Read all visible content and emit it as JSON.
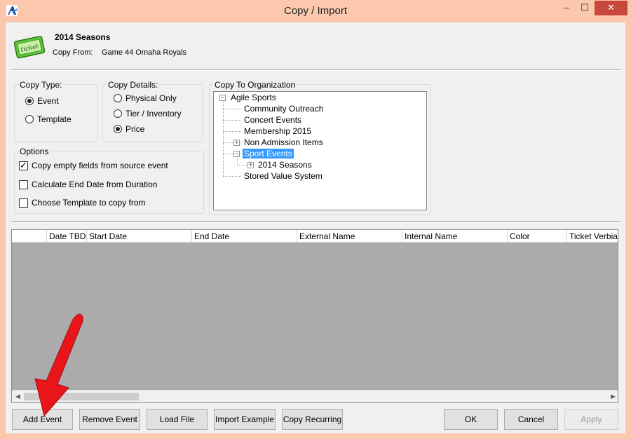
{
  "window": {
    "title": "Copy / Import",
    "minimize_glyph": "–",
    "maximize_glyph": "☐",
    "close_glyph": "✕"
  },
  "header": {
    "title": "2014 Seasons",
    "copy_from_label": "Copy From:",
    "copy_from_value": "Game 44 Omaha Royals",
    "icon": "ticket-icon",
    "icon_text": "ticket"
  },
  "copy_type": {
    "label": "Copy Type:",
    "options": [
      {
        "label": "Event",
        "checked": true
      },
      {
        "label": "Template",
        "checked": false
      }
    ]
  },
  "copy_details": {
    "label": "Copy Details:",
    "options": [
      {
        "label": "Physical Only",
        "checked": false
      },
      {
        "label": "Tier / Inventory",
        "checked": false
      },
      {
        "label": "Price",
        "checked": true
      }
    ]
  },
  "options": {
    "label": "Options",
    "items": [
      {
        "label": "Copy empty fields from source event",
        "checked": true
      },
      {
        "label": "Calculate End Date from Duration",
        "checked": false
      },
      {
        "label": "Choose Template to copy from",
        "checked": false
      }
    ]
  },
  "copy_to_org": {
    "label": "Copy To Organization",
    "root": "Agile Sports",
    "children": [
      {
        "label": "Community Outreach"
      },
      {
        "label": "Concert Events"
      },
      {
        "label": "Membership 2015"
      },
      {
        "label": "Non Admission Items"
      },
      {
        "label": "Sport Events",
        "selected": true
      },
      {
        "label": "2014 Seasons"
      },
      {
        "label": "Stored Value System"
      }
    ],
    "expand_plus": "+",
    "expand_minus": "−"
  },
  "grid": {
    "columns": [
      "Date TBD",
      "Start Date",
      "End Date",
      "External Name",
      "Internal Name",
      "Color",
      "Ticket Verbiage"
    ],
    "scroll_left": "◀",
    "scroll_right": "▶"
  },
  "buttons": {
    "add_event": "Add Event",
    "remove_event": "Remove Event",
    "load_file": "Load File",
    "import_example": "Import Example",
    "copy_recurring": "Copy Recurring",
    "ok": "OK",
    "cancel": "Cancel",
    "apply": "Apply"
  },
  "colors": {
    "title_bar": "#fbc8ad",
    "close_button": "#c7493e",
    "selection": "#3399ff",
    "annotation_arrow": "#e8151b"
  }
}
